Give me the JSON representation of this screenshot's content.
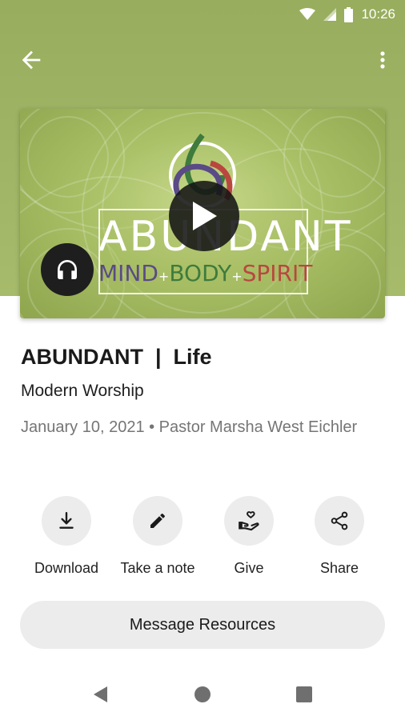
{
  "status_bar": {
    "time": "10:26",
    "icons": [
      "wifi-icon",
      "cell-signal-icon",
      "battery-icon"
    ]
  },
  "toolbar": {
    "back_icon": "arrow-left-icon",
    "more_icon": "more-vertical-icon"
  },
  "artwork": {
    "word": "ABUNDANT",
    "sub_mind": "MIND",
    "sub_body": "BODY",
    "sub_spirit": "SPIRIT",
    "plus": "+",
    "colors": {
      "mind": "#5a4a86",
      "body": "#3e7b3c",
      "spirit": "#b9473f"
    }
  },
  "media": {
    "play_icon": "play-icon",
    "audio_icon": "headphones-icon"
  },
  "message": {
    "title": "ABUNDANT  |  Life",
    "series": "Modern Worship",
    "meta": "January 10, 2021 • Pastor Marsha West Eichler"
  },
  "actions": [
    {
      "label": "Download",
      "icon": "download-icon"
    },
    {
      "label": "Take a note",
      "icon": "pencil-icon"
    },
    {
      "label": "Give",
      "icon": "give-heart-hand-icon"
    },
    {
      "label": "Share",
      "icon": "share-icon"
    }
  ],
  "resources_button": {
    "label": "Message Resources"
  },
  "nav": {
    "icons": [
      "back-triangle-icon",
      "home-circle-icon",
      "recents-square-icon"
    ]
  },
  "theme": {
    "hero": "#a2b766",
    "surface": "#ececec",
    "text": "#1a1a1a",
    "muted": "#757575"
  }
}
